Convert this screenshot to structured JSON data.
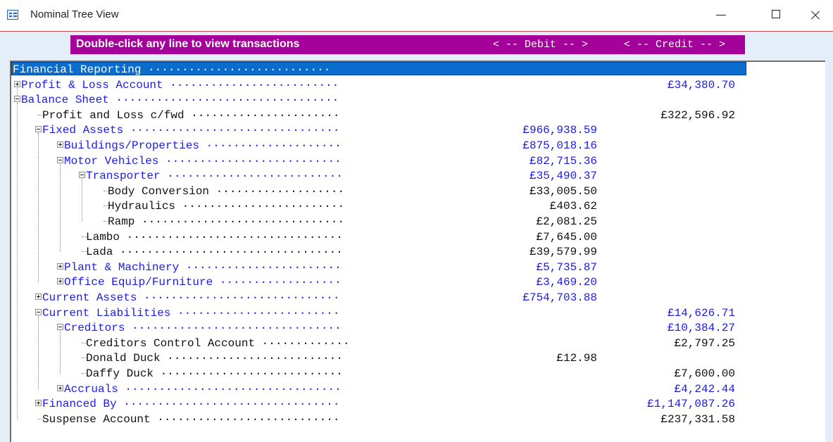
{
  "window": {
    "title": "Nominal Tree View"
  },
  "header": {
    "hint": "Double-click any line to view transactions",
    "debit_label": "< -- Debit -- >",
    "credit_label": "< -- Credit -- >"
  },
  "rows": [
    {
      "label": "Financial Reporting ···························",
      "debit": "",
      "credit": "",
      "color": "white",
      "level": 0,
      "toggle": "",
      "selected": true
    },
    {
      "label": "Profit & Loss Account ·························",
      "debit": "",
      "credit": "£34,380.70",
      "color": "blue",
      "level": 0,
      "toggle": "plus"
    },
    {
      "label": "Balance Sheet ·································",
      "debit": "",
      "credit": "",
      "color": "blue",
      "level": 0,
      "toggle": "minus"
    },
    {
      "label": "Profit and Loss c/fwd ······················",
      "debit": "",
      "credit": "£322,596.92",
      "color": "black",
      "level": 1,
      "toggle": ""
    },
    {
      "label": "Fixed Assets ·······························",
      "debit": "£966,938.59",
      "credit": "",
      "color": "blue",
      "level": 1,
      "toggle": "minus"
    },
    {
      "label": "Buildings/Properties ····················",
      "debit": "£875,018.16",
      "credit": "",
      "color": "blue",
      "level": 2,
      "toggle": "plus"
    },
    {
      "label": "Motor Vehicles ··························",
      "debit": "£82,715.36",
      "credit": "",
      "color": "blue",
      "level": 2,
      "toggle": "minus"
    },
    {
      "label": "Transporter ··························",
      "debit": "£35,490.37",
      "credit": "",
      "color": "blue",
      "level": 3,
      "toggle": "minus"
    },
    {
      "label": "Body Conversion ···················",
      "debit": "£33,005.50",
      "credit": "",
      "color": "black",
      "level": 4,
      "toggle": ""
    },
    {
      "label": "Hydraulics ························",
      "debit": "£403.62",
      "credit": "",
      "color": "black",
      "level": 4,
      "toggle": ""
    },
    {
      "label": "Ramp ······························",
      "debit": "£2,081.25",
      "credit": "",
      "color": "black",
      "level": 4,
      "toggle": ""
    },
    {
      "label": "Lambo ································",
      "debit": "£7,645.00",
      "credit": "",
      "color": "black",
      "level": 3,
      "toggle": ""
    },
    {
      "label": "Lada ·································",
      "debit": "£39,579.99",
      "credit": "",
      "color": "black",
      "level": 3,
      "toggle": ""
    },
    {
      "label": "Plant & Machinery ·······················",
      "debit": "£5,735.87",
      "credit": "",
      "color": "blue",
      "level": 2,
      "toggle": "plus"
    },
    {
      "label": "Office Equip/Furniture ··················",
      "debit": "£3,469.20",
      "credit": "",
      "color": "blue",
      "level": 2,
      "toggle": "plus"
    },
    {
      "label": "Current Assets ·····························",
      "debit": "£754,703.88",
      "credit": "",
      "color": "blue",
      "level": 1,
      "toggle": "plus"
    },
    {
      "label": "Current Liabilities ························",
      "debit": "",
      "credit": "£14,626.71",
      "color": "blue",
      "level": 1,
      "toggle": "minus"
    },
    {
      "label": "Creditors ·······························",
      "debit": "",
      "credit": "£10,384.27",
      "color": "blue",
      "level": 2,
      "toggle": "minus"
    },
    {
      "label": "Creditors Control Account ·············",
      "debit": "",
      "credit": "£2,797.25",
      "color": "black",
      "level": 3,
      "toggle": ""
    },
    {
      "label": "Donald Duck ··························",
      "debit": "£12.98",
      "credit": "",
      "color": "black",
      "level": 3,
      "toggle": ""
    },
    {
      "label": "Daffy Duck ···························",
      "debit": "",
      "credit": "£7,600.00",
      "color": "black",
      "level": 3,
      "toggle": ""
    },
    {
      "label": "Accruals ································",
      "debit": "",
      "credit": "£4,242.44",
      "color": "blue",
      "level": 2,
      "toggle": "plus"
    },
    {
      "label": "Financed By ································",
      "debit": "",
      "credit": "£1,147,087.26",
      "color": "blue",
      "level": 1,
      "toggle": "plus"
    },
    {
      "label": "Suspense Account ···························",
      "debit": "",
      "credit": "£237,331.58",
      "color": "black",
      "level": 1,
      "toggle": ""
    }
  ]
}
